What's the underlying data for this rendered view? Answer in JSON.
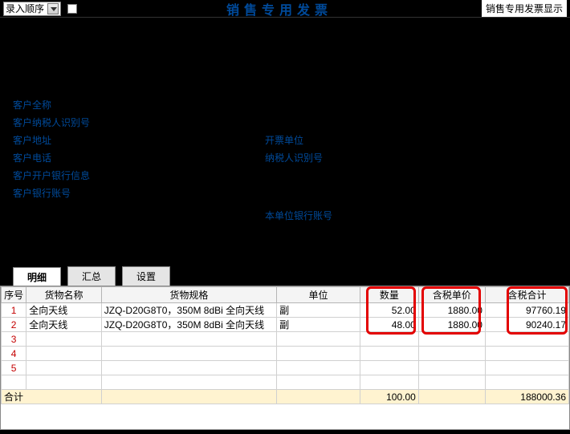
{
  "topbar": {
    "dropdown_label": "录入顺序",
    "title_center": "销售专用发票",
    "right_label": "销售专用发票显示"
  },
  "form": {
    "left": [
      "客户全称",
      "客户纳税人识别号",
      "客户地址",
      "客户电话",
      "客户开户银行信息",
      "客户银行账号"
    ],
    "right": [
      "开票单位",
      "纳税人识别号",
      "本单位银行账号"
    ]
  },
  "tabs": {
    "t0": "明细",
    "t1": "汇总",
    "t2": "设置"
  },
  "grid": {
    "headers": {
      "seq": "序号",
      "name": "货物名称",
      "spec": "货物规格",
      "unit": "单位",
      "qty": "数量",
      "price": "含税单价",
      "amount": "含税合计"
    },
    "rows": [
      {
        "seq": "1",
        "name": "全向天线",
        "spec": "JZQ-D20G8T0，350M 8dBi 全向天线",
        "unit": "副",
        "qty": "52.00",
        "price": "1880.00",
        "amount": "97760.19"
      },
      {
        "seq": "2",
        "name": "全向天线",
        "spec": "JZQ-D20G8T0，350M 8dBi 全向天线",
        "unit": "副",
        "qty": "48.00",
        "price": "1880.00",
        "amount": "90240.17"
      }
    ],
    "total_label": "合计",
    "total_qty": "100.00",
    "total_amount": "188000.36"
  }
}
